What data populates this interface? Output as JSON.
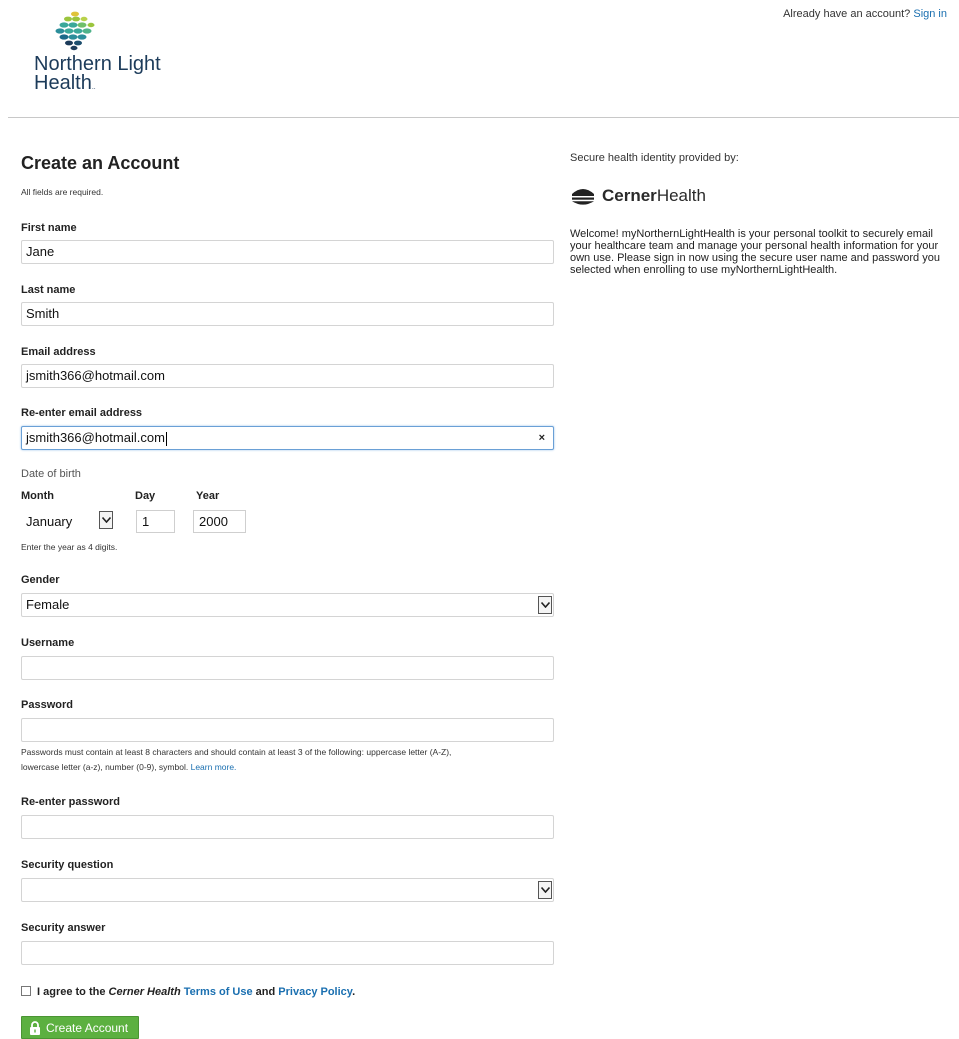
{
  "brand": {
    "name_line1": "Northern Light",
    "name_line2": "Health",
    "tm": "..",
    "colors": {
      "teal": "#3aa89a",
      "navy": "#1c3b5a",
      "lime": "#9bc53d",
      "yellow": "#e0c33a"
    }
  },
  "header": {
    "signin_prompt": "Already have an account?",
    "signin_link": "Sign in"
  },
  "form": {
    "title": "Create an Account",
    "required_note": "All fields are required.",
    "first_name": {
      "label": "First name",
      "value": "Jane"
    },
    "last_name": {
      "label": "Last name",
      "value": "Smith"
    },
    "email": {
      "label": "Email address",
      "value": "jsmith366@hotmail.com"
    },
    "email_confirm": {
      "label": "Re-enter email address",
      "value": "jsmith366@hotmail.com",
      "clear_icon": "×"
    },
    "dob": {
      "title": "Date of birth",
      "month_label": "Month",
      "month_value": "January",
      "day_label": "Day",
      "day_value": "1",
      "year_label": "Year",
      "year_value": "2000",
      "hint": "Enter the year as 4 digits."
    },
    "gender": {
      "label": "Gender",
      "value": "Female"
    },
    "username": {
      "label": "Username",
      "value": ""
    },
    "password": {
      "label": "Password",
      "value": "",
      "hint_line1": "Passwords must contain at least 8 characters and should contain at least 3 of the following: uppercase letter (A-Z),",
      "hint_line2": "lowercase letter (a-z), number (0-9), symbol.",
      "learn_more": "Learn more."
    },
    "password_confirm": {
      "label": "Re-enter password",
      "value": ""
    },
    "security_question": {
      "label": "Security question",
      "value": ""
    },
    "security_answer": {
      "label": "Security answer",
      "value": ""
    },
    "agree": {
      "prefix": "I agree to the",
      "company": "Cerner Health",
      "terms": "Terms of Use",
      "and": "and",
      "privacy": "Privacy Policy",
      "suffix": "."
    },
    "submit_label": "Create Account",
    "submit_color": "#5cb040"
  },
  "side": {
    "provided_by": "Secure health identity provided by:",
    "cerner_bold": "Cerner",
    "cerner_light": "Health",
    "welcome": "Welcome! myNorthernLightHealth is your personal toolkit to securely email your healthcare team and manage your personal health information for your own use. Please sign in now using the secure user name and password you selected when enrolling to use myNorthernLightHealth."
  }
}
